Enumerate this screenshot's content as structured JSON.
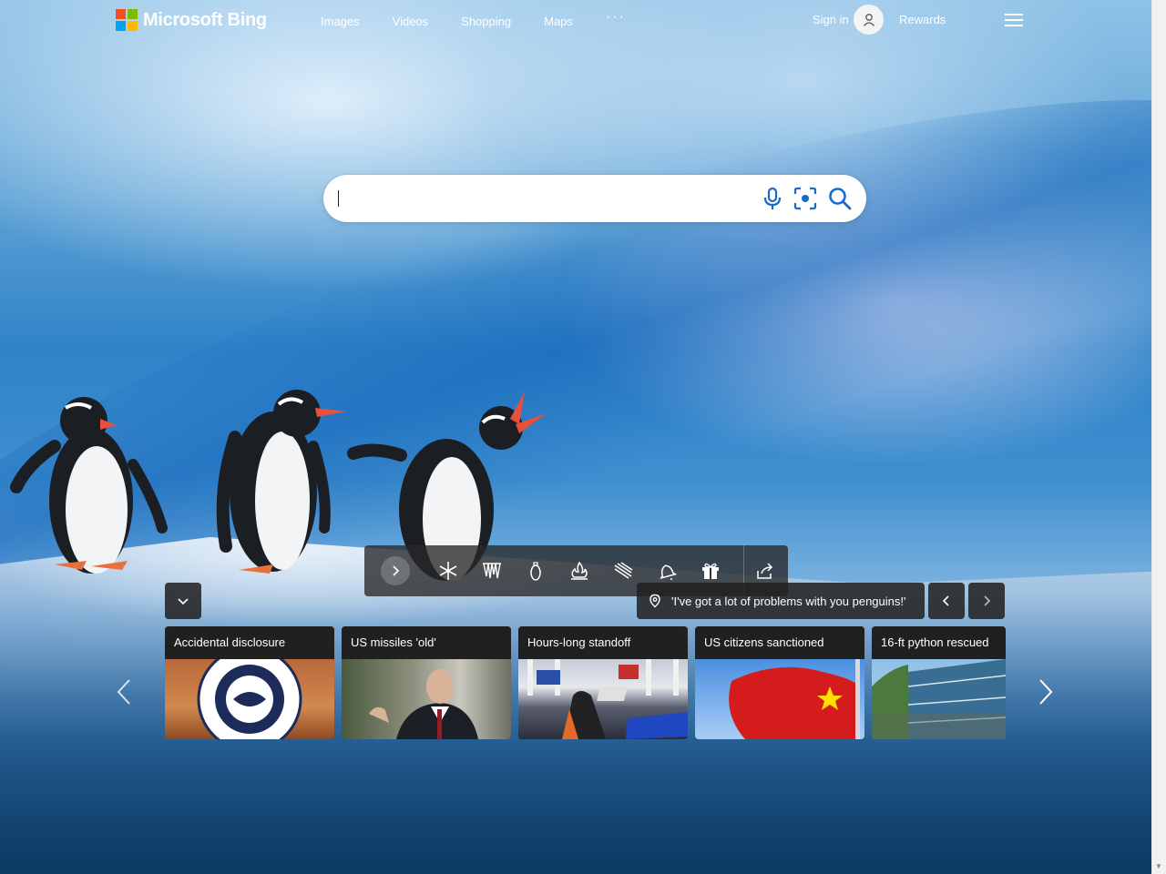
{
  "header": {
    "brand": "Microsoft Bing",
    "nav": [
      "Images",
      "Videos",
      "Shopping",
      "Maps"
    ],
    "more": "···",
    "signin": "Sign in",
    "rewards": "Rewards"
  },
  "search": {
    "value": ""
  },
  "caption": {
    "text": "'I've got a lot of problems with you penguins!'"
  },
  "toolbar": {
    "icons": [
      "chevron-right-icon",
      "snowflake-icon",
      "icicles-icon",
      "ornament-icon",
      "fire-icon",
      "wind-icon",
      "bell-icon",
      "gift-icon",
      "share-icon"
    ]
  },
  "news": [
    {
      "title": "Accidental disclosure"
    },
    {
      "title": "US missiles 'old'"
    },
    {
      "title": "Hours-long standoff"
    },
    {
      "title": "US citizens sanctioned"
    },
    {
      "title": "16-ft python rescued"
    }
  ],
  "colors": {
    "ms_red": "#f25022",
    "ms_green": "#7fba00",
    "ms_blue": "#00a4ef",
    "ms_yellow": "#ffb900",
    "bing_blue": "#1b6ac9"
  }
}
